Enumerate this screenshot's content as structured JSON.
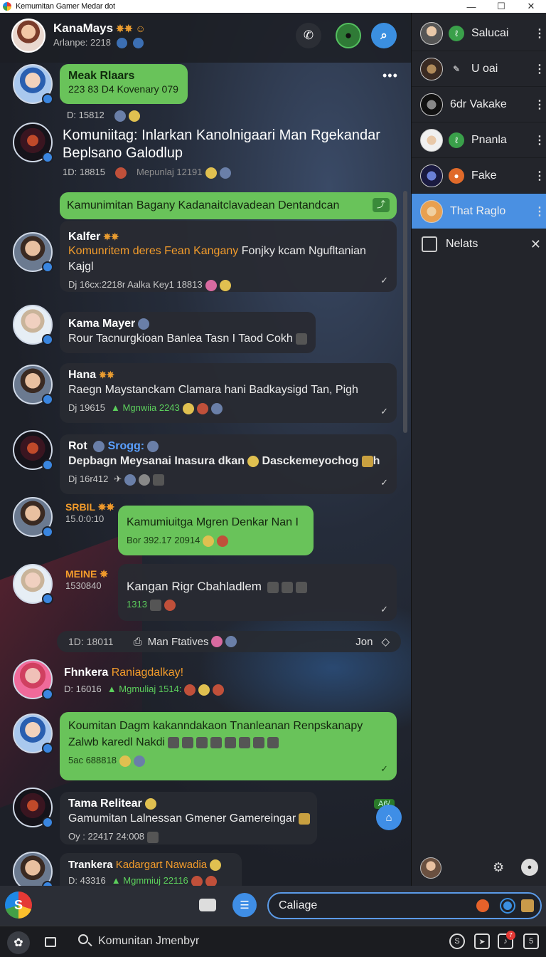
{
  "window": {
    "title": "Kemumitan Gamer Medar dot"
  },
  "header": {
    "name": "KanaMays",
    "subtitle": "Arlanpe: 2218"
  },
  "messages": {
    "m1": {
      "sender": "Meak Rlaars",
      "line": "223 83 D4 Kovenary 079",
      "meta": "D: 15812"
    },
    "m2": {
      "text": "Komuniitag: Inlarkan Kanolnigaari Man Rgekandar Beplsano Galodlup",
      "meta": "1D: 18815",
      "meta2": "Mepunlaj 12191"
    },
    "m3": {
      "text": "Kamunimitan Bagany Kadanaitclavadean Dentandcan"
    },
    "m4": {
      "sender": "Kalfer",
      "text_orange": "Komunritem deres Fean Kangany",
      "text": "Fonjky kcam Ngufltanian Kajgl",
      "meta": "Dj 16cx:2218r  Aalka Key1 18813"
    },
    "m5": {
      "sender": "Kama Mayer",
      "text": "Rour Tacnurgkioan Banlea Tasn I Taod Cokh"
    },
    "m6": {
      "sender": "Hana",
      "text": "Raegn Maystanckam Clamara hani Badkaysigd Tan, Pigh",
      "meta": "Dj 19615",
      "meta_green": "Mgnwiia 2243"
    },
    "m7": {
      "sender": "Rot",
      "sender2": "Srogg:",
      "text": "Depbagn Meysanai Inasura dkan",
      "text2": "Dasckemeyochog",
      "text3": "h",
      "meta": "Dj 16r412"
    },
    "m8": {
      "sender": "SRBIL",
      "time": "15.0:0:10",
      "text": "Kamumiuitga Mgren Denkar Nan I",
      "meta": "Bor 392.17 20914"
    },
    "m9": {
      "sender": "MEINE",
      "time": "1530840",
      "text": "Kangan Rigr Cbahladlem",
      "meta": "1313"
    },
    "date_row": {
      "date": "1D: 18011",
      "label": "Man Ftatives",
      "right": "Jon"
    },
    "m10": {
      "sender": "Fhnkera",
      "sender_orange": "Raniagdalkay!",
      "meta": "D: 16016",
      "meta_green": "Mgmuliaj 1514:"
    },
    "m11": {
      "text": "Koumitan Dagm kakanndakaon Tnanleanan Renpskanapy",
      "text2": "Zalwb karedl Nakdi",
      "meta": "5ac 688818"
    },
    "m12": {
      "sender": "Tama Relitear",
      "text": "Gamumitan Lalnessan Gmener Gamereingar",
      "meta": "Oy : 22417 24:008",
      "tag": "A6/"
    },
    "m13": {
      "sender": "Trankera",
      "sender_orange": "Kadargart Nawadia",
      "meta": "D: 43316",
      "meta_green": "Mgmmiuj 22116"
    }
  },
  "sidebar": {
    "items": [
      {
        "label": "Salucai",
        "icon": "leaf-icon"
      },
      {
        "label": "U oai",
        "icon": "pen-icon"
      },
      {
        "label": "6dr Vakake",
        "icon": "none"
      },
      {
        "label": "Pnanla",
        "icon": "leaf-icon"
      },
      {
        "label": "Fake",
        "icon": "controller-icon"
      },
      {
        "label": "That Raglo",
        "icon": "none"
      }
    ],
    "notes_label": "Nelats"
  },
  "composer": {
    "input_value": "Caliage"
  },
  "taskbar": {
    "search_placeholder": "Komunitan Jmenbyr",
    "notif_count": "7"
  },
  "colors": {
    "accent": "#4a90e2",
    "bubble_green": "#69c35a",
    "bubble_dark": "#282b32",
    "highlight_orange": "#f39c2b"
  }
}
